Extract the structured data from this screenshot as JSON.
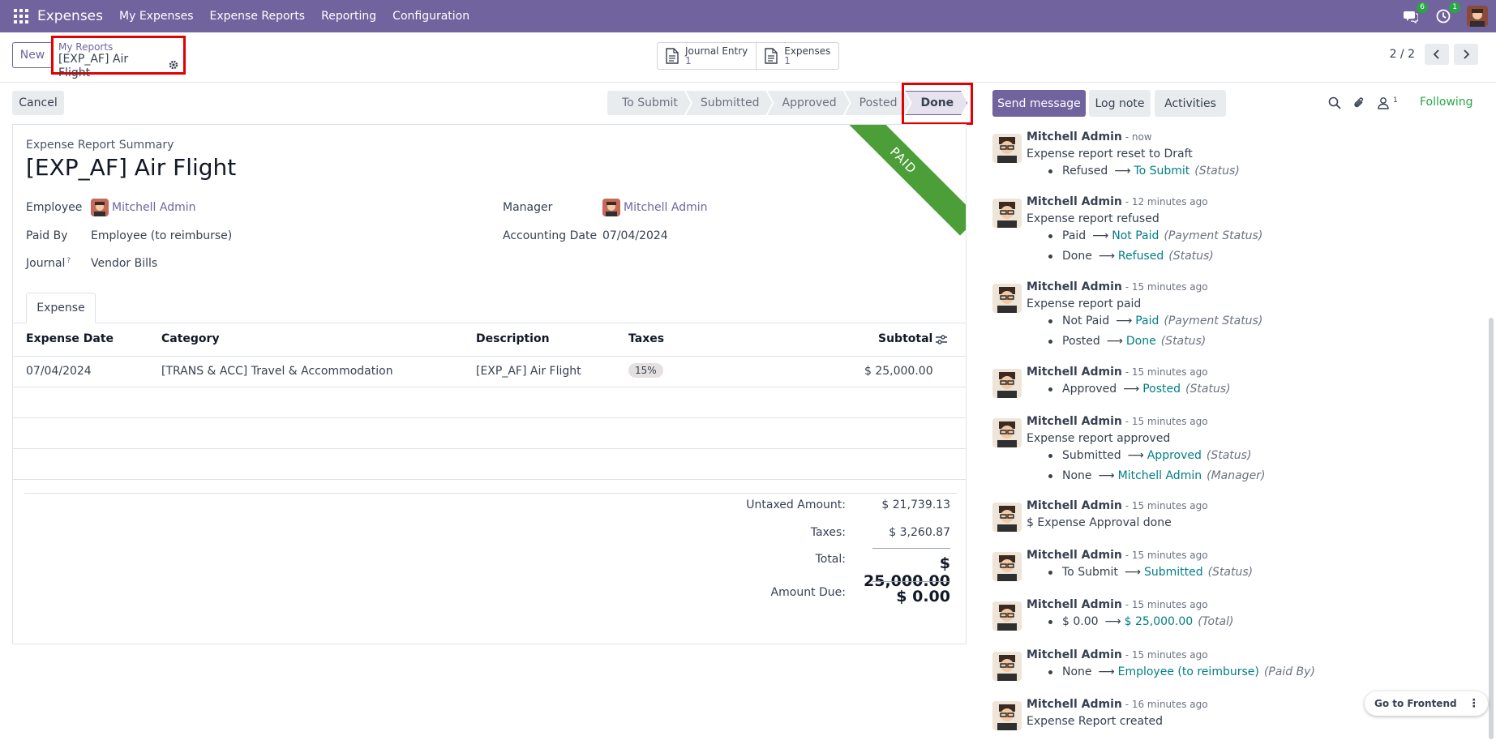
{
  "topbar": {
    "app_name": "Expenses",
    "menu": [
      "My Expenses",
      "Expense Reports",
      "Reporting",
      "Configuration"
    ],
    "messages_badge": "6",
    "activities_badge": "1",
    "bg_color": "#71639e"
  },
  "control": {
    "new_label": "New",
    "breadcrumb_parent": "My Reports",
    "breadcrumb_current": "[EXP_AF] Air Flight",
    "smart_buttons": [
      {
        "label": "Journal Entry",
        "count": "1",
        "icon": "document-icon"
      },
      {
        "label": "Expenses",
        "count": "1",
        "icon": "document-icon"
      }
    ],
    "pager": "2 / 2"
  },
  "status": {
    "cancel_label": "Cancel",
    "stages": [
      "To Submit",
      "Submitted",
      "Approved",
      "Posted",
      "Done"
    ],
    "active_stage": "Done"
  },
  "form": {
    "summary_label": "Expense Report Summary",
    "title": "[EXP_AF] Air Flight",
    "ribbon": "PAID",
    "employee_label": "Employee",
    "employee_value": "Mitchell Admin",
    "paid_by_label": "Paid By",
    "paid_by_value": "Employee (to reimburse)",
    "journal_label": "Journal",
    "journal_help": "?",
    "journal_value": "Vendor Bills",
    "manager_label": "Manager",
    "manager_value": "Mitchell Admin",
    "acc_date_label": "Accounting Date",
    "acc_date_value": "07/04/2024",
    "tab": "Expense",
    "table": {
      "headers": [
        "Expense Date",
        "Category",
        "Description",
        "Taxes",
        "Subtotal"
      ],
      "rows": [
        {
          "date": "07/04/2024",
          "category": "[TRANS & ACC] Travel & Accommodation",
          "description": "[EXP_AF] Air Flight",
          "taxes": "15%",
          "subtotal": "$ 25,000.00"
        }
      ]
    },
    "totals": {
      "untaxed_label": "Untaxed Amount:",
      "untaxed_value": "$ 21,739.13",
      "taxes_label": "Taxes:",
      "taxes_value": "$ 3,260.87",
      "total_label": "Total:",
      "total_value": "$ 25,000.00",
      "due_label": "Amount Due:",
      "due_value": "$ 0.00"
    }
  },
  "chatter": {
    "send_message": "Send message",
    "log_note": "Log note",
    "activities": "Activities",
    "followers_count": "1",
    "following": "Following",
    "messages": [
      {
        "author": "Mitchell Admin",
        "time": "- now",
        "body": "Expense report reset to Draft",
        "tracks": [
          {
            "old": "Refused",
            "new": "To Submit",
            "field": "(Status)"
          }
        ]
      },
      {
        "author": "Mitchell Admin",
        "time": "- 12 minutes ago",
        "body": "Expense report refused",
        "tracks": [
          {
            "old": "Paid",
            "new": "Not Paid",
            "field": "(Payment Status)"
          },
          {
            "old": "Done",
            "new": "Refused",
            "field": "(Status)"
          }
        ]
      },
      {
        "author": "Mitchell Admin",
        "time": "- 15 minutes ago",
        "body": "Expense report paid",
        "tracks": [
          {
            "old": "Not Paid",
            "new": "Paid",
            "field": "(Payment Status)"
          },
          {
            "old": "Posted",
            "new": "Done",
            "field": "(Status)"
          }
        ]
      },
      {
        "author": "Mitchell Admin",
        "time": "- 15 minutes ago",
        "body": "",
        "tracks": [
          {
            "old": "Approved",
            "new": "Posted",
            "field": "(Status)"
          }
        ]
      },
      {
        "author": "Mitchell Admin",
        "time": "- 15 minutes ago",
        "body": "Expense report approved",
        "tracks": [
          {
            "old": "Submitted",
            "new": "Approved",
            "field": "(Status)"
          },
          {
            "old": "None",
            "new": "Mitchell Admin",
            "field": "(Manager)"
          }
        ]
      },
      {
        "author": "Mitchell Admin",
        "time": "- 15 minutes ago",
        "body": "$ Expense Approval done",
        "tracks": []
      },
      {
        "author": "Mitchell Admin",
        "time": "- 15 minutes ago",
        "body": "",
        "tracks": [
          {
            "old": "To Submit",
            "new": "Submitted",
            "field": "(Status)"
          }
        ]
      },
      {
        "author": "Mitchell Admin",
        "time": "- 15 minutes ago",
        "body": "",
        "tracks": [
          {
            "old": "$ 0.00",
            "new": "$ 25,000.00",
            "field": "(Total)"
          }
        ]
      },
      {
        "author": "Mitchell Admin",
        "time": "- 15 minutes ago",
        "body": "",
        "tracks": [
          {
            "old": "None",
            "new": "Employee (to reimburse)",
            "field": "(Paid By)"
          }
        ]
      },
      {
        "author": "Mitchell Admin",
        "time": "- 16 minutes ago",
        "body": "Expense Report created",
        "tracks": []
      }
    ]
  },
  "go_frontend": "Go to Frontend"
}
